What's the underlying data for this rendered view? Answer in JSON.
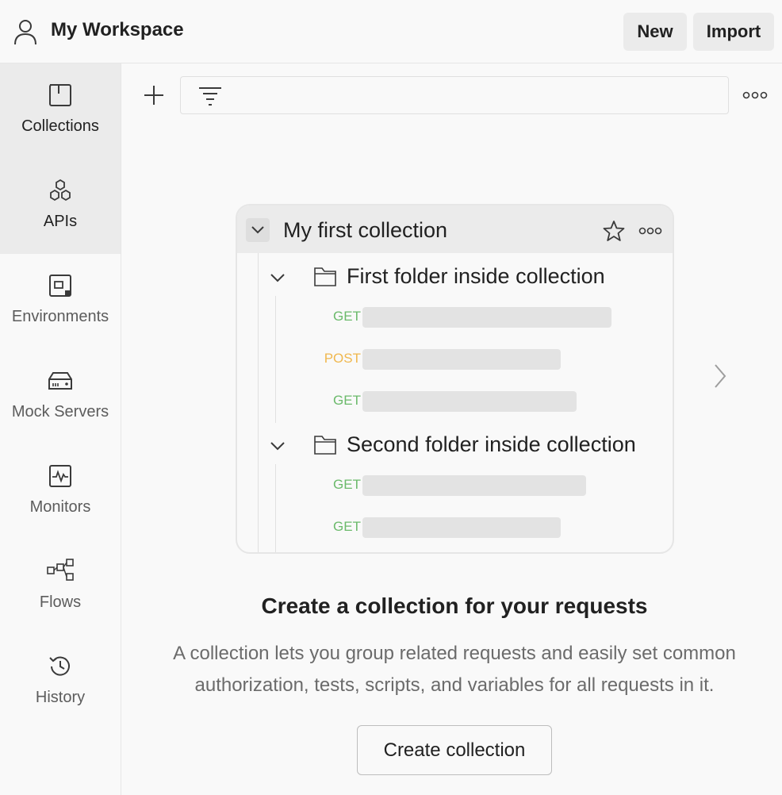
{
  "header": {
    "workspace_title": "My Workspace",
    "new_label": "New",
    "import_label": "Import"
  },
  "sidebar": {
    "items": [
      {
        "label": "Collections",
        "icon": "collections-icon",
        "active": true
      },
      {
        "label": "APIs",
        "icon": "apis-icon",
        "active": true
      },
      {
        "label": "Environments",
        "icon": "environments-icon",
        "active": false
      },
      {
        "label": "Mock Servers",
        "icon": "mock-servers-icon",
        "active": false
      },
      {
        "label": "Monitors",
        "icon": "monitors-icon",
        "active": false
      },
      {
        "label": "Flows",
        "icon": "flows-icon",
        "active": false
      },
      {
        "label": "History",
        "icon": "history-icon",
        "active": false
      }
    ]
  },
  "toolbar": {
    "filter_placeholder": ""
  },
  "illustration": {
    "collection_title": "My first collection",
    "folders": [
      {
        "label": "First folder inside collection",
        "requests": [
          "GET",
          "POST",
          "GET"
        ]
      },
      {
        "label": "Second folder inside collection",
        "requests": [
          "GET",
          "GET"
        ]
      }
    ]
  },
  "empty_state": {
    "title": "Create a collection for your requests",
    "description": "A collection lets you group related requests and easily set common authorization, tests, scripts, and variables for all requests in it.",
    "button_label": "Create collection"
  },
  "colors": {
    "get_method": "#6bba6b",
    "post_method": "#f0b84f",
    "active_bg": "#ebebeb"
  }
}
